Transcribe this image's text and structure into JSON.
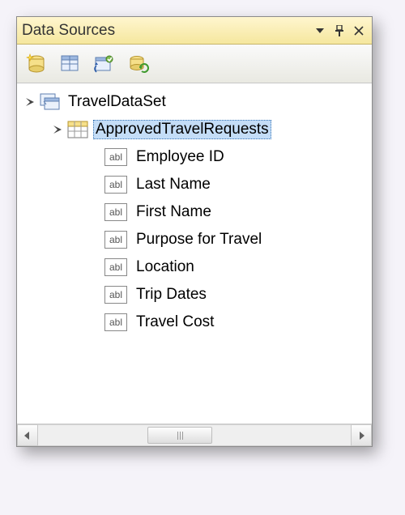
{
  "panel": {
    "title": "Data Sources"
  },
  "toolbar": {
    "buttons": [
      {
        "name": "add-new-data-source-icon"
      },
      {
        "name": "edit-dataset-designer-icon"
      },
      {
        "name": "configure-dataset-icon"
      },
      {
        "name": "refresh-icon"
      }
    ]
  },
  "tree": {
    "dataset": {
      "label": "TravelDataSet",
      "expanded": true,
      "tables": [
        {
          "label": "ApprovedTravelRequests",
          "expanded": true,
          "selected": true,
          "columns": [
            {
              "label": "Employee ID"
            },
            {
              "label": "Last Name"
            },
            {
              "label": "First Name"
            },
            {
              "label": "Purpose for Travel"
            },
            {
              "label": "Location"
            },
            {
              "label": "Trip Dates"
            },
            {
              "label": "Travel Cost"
            }
          ]
        }
      ]
    }
  },
  "abl_label": "abl"
}
